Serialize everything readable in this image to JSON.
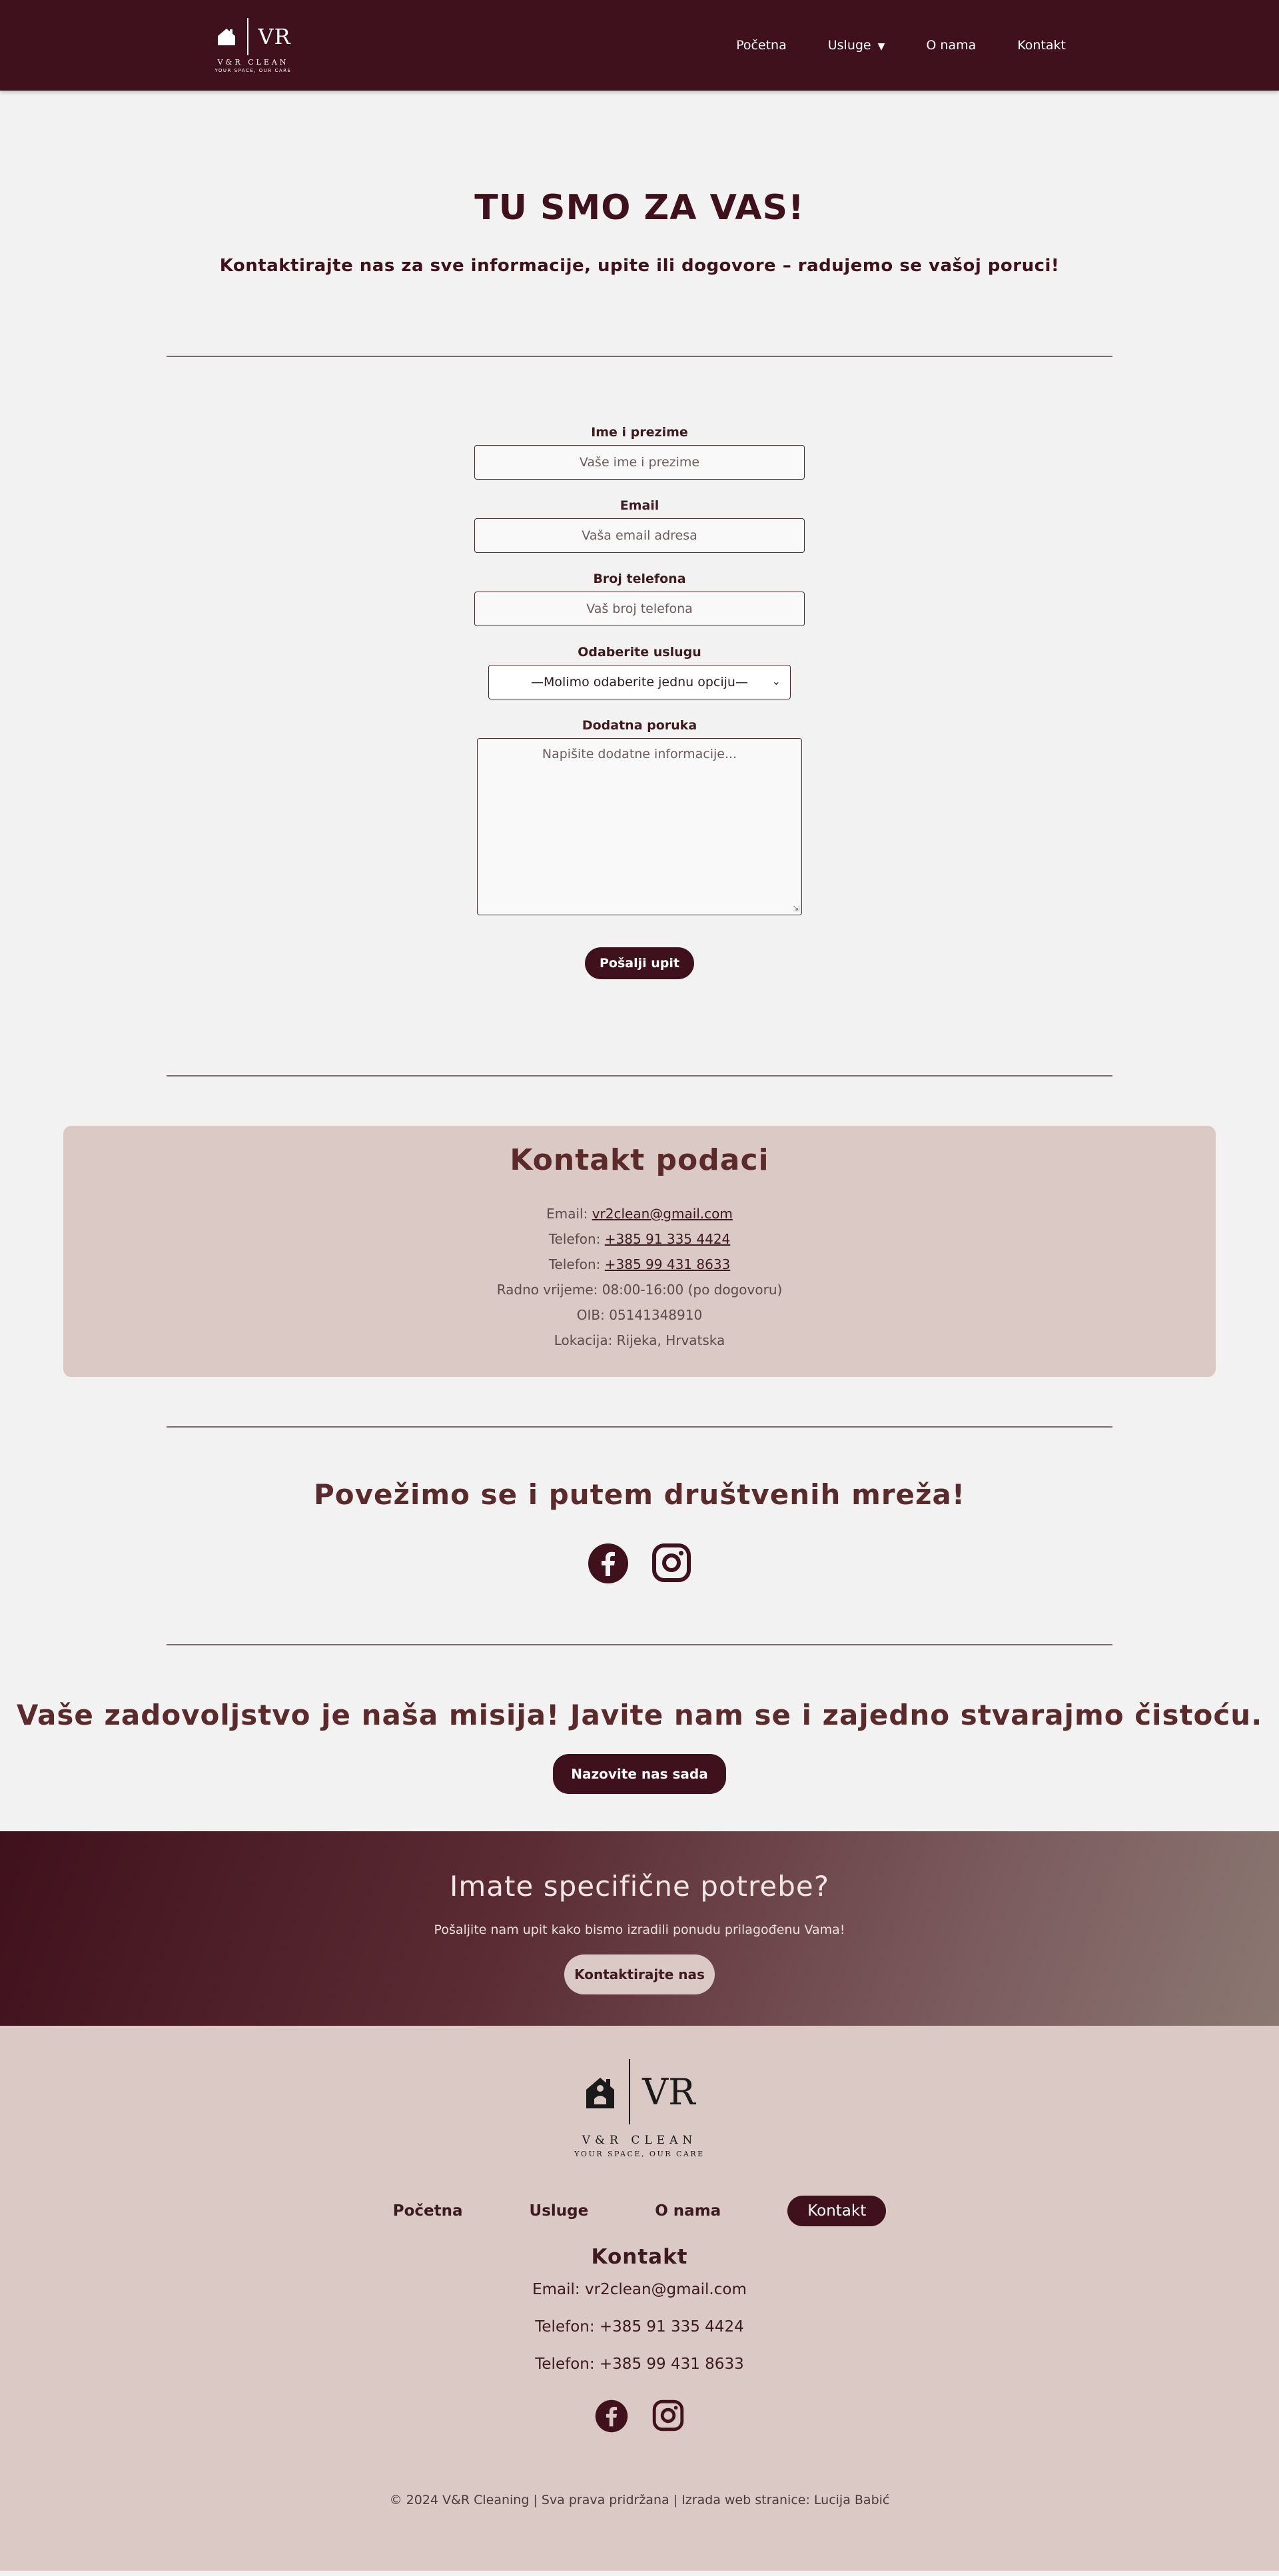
{
  "brand": {
    "vr": "VR",
    "name": "V&R CLEAN",
    "tagline": "YOUR SPACE, OUR CARE"
  },
  "nav": {
    "items": [
      "Početna",
      "Usluge",
      "O nama",
      "Kontakt"
    ],
    "dropdown_caret": "▼"
  },
  "hero": {
    "title": "TU SMO ZA VAS!",
    "subtitle": "Kontaktirajte nas za sve informacije, upite ili dogovore – radujemo se vašoj poruci!"
  },
  "form": {
    "name_label": "Ime i prezime",
    "name_placeholder": "Vaše ime i prezime",
    "email_label": "Email",
    "email_placeholder": "Vaša email adresa",
    "phone_label": "Broj telefona",
    "phone_placeholder": "Vaš broj telefona",
    "service_label": "Odaberite uslugu",
    "service_selected": "—Molimo odaberite jednu opciju—",
    "message_label": "Dodatna poruka",
    "message_placeholder": "Napišite dodatne informacije...",
    "submit_label": "Pošalji upit"
  },
  "contact": {
    "title": "Kontakt podaci",
    "email_prefix": "Email: ",
    "email": "vr2clean@gmail.com",
    "phone_prefix": "Telefon: ",
    "phone1": "+385 91 335 4424",
    "phone2": "+385 99 431 8633",
    "hours": "Radno vrijeme: 08:00-16:00 (po dogovoru)",
    "oib": "OIB: 05141348910",
    "location": "Lokacija: Rijeka, Hrvatska"
  },
  "social": {
    "title": "Povežimo se i putem društvenih mreža!",
    "icons": [
      "facebook-icon",
      "instagram-icon"
    ]
  },
  "mission": {
    "title": "Vaše zadovoljstvo je naša misija! Javite nam se i zajedno stvarajmo čistoću.",
    "button": "Nazovite nas sada"
  },
  "cta": {
    "title": "Imate specifične potrebe?",
    "text": "Pošaljite nam upit kako bismo izradili ponudu prilagođenu Vama!",
    "button": "Kontaktirajte nas"
  },
  "footer": {
    "nav": [
      "Početna",
      "Usluge",
      "O nama",
      "Kontakt"
    ],
    "contact_title": "Kontakt",
    "email": "Email: vr2clean@gmail.com",
    "phone1": "Telefon: +385 91 335 4424",
    "phone2": "Telefon: +385 99 431 8633",
    "copyright": "© 2024 V&R Cleaning | Sva prava pridržana | Izrada web stranice: Lucija Babić"
  },
  "colors": {
    "primary": "#3f111c",
    "beige": "#dbc9c5",
    "background": "#f2f2f2"
  }
}
